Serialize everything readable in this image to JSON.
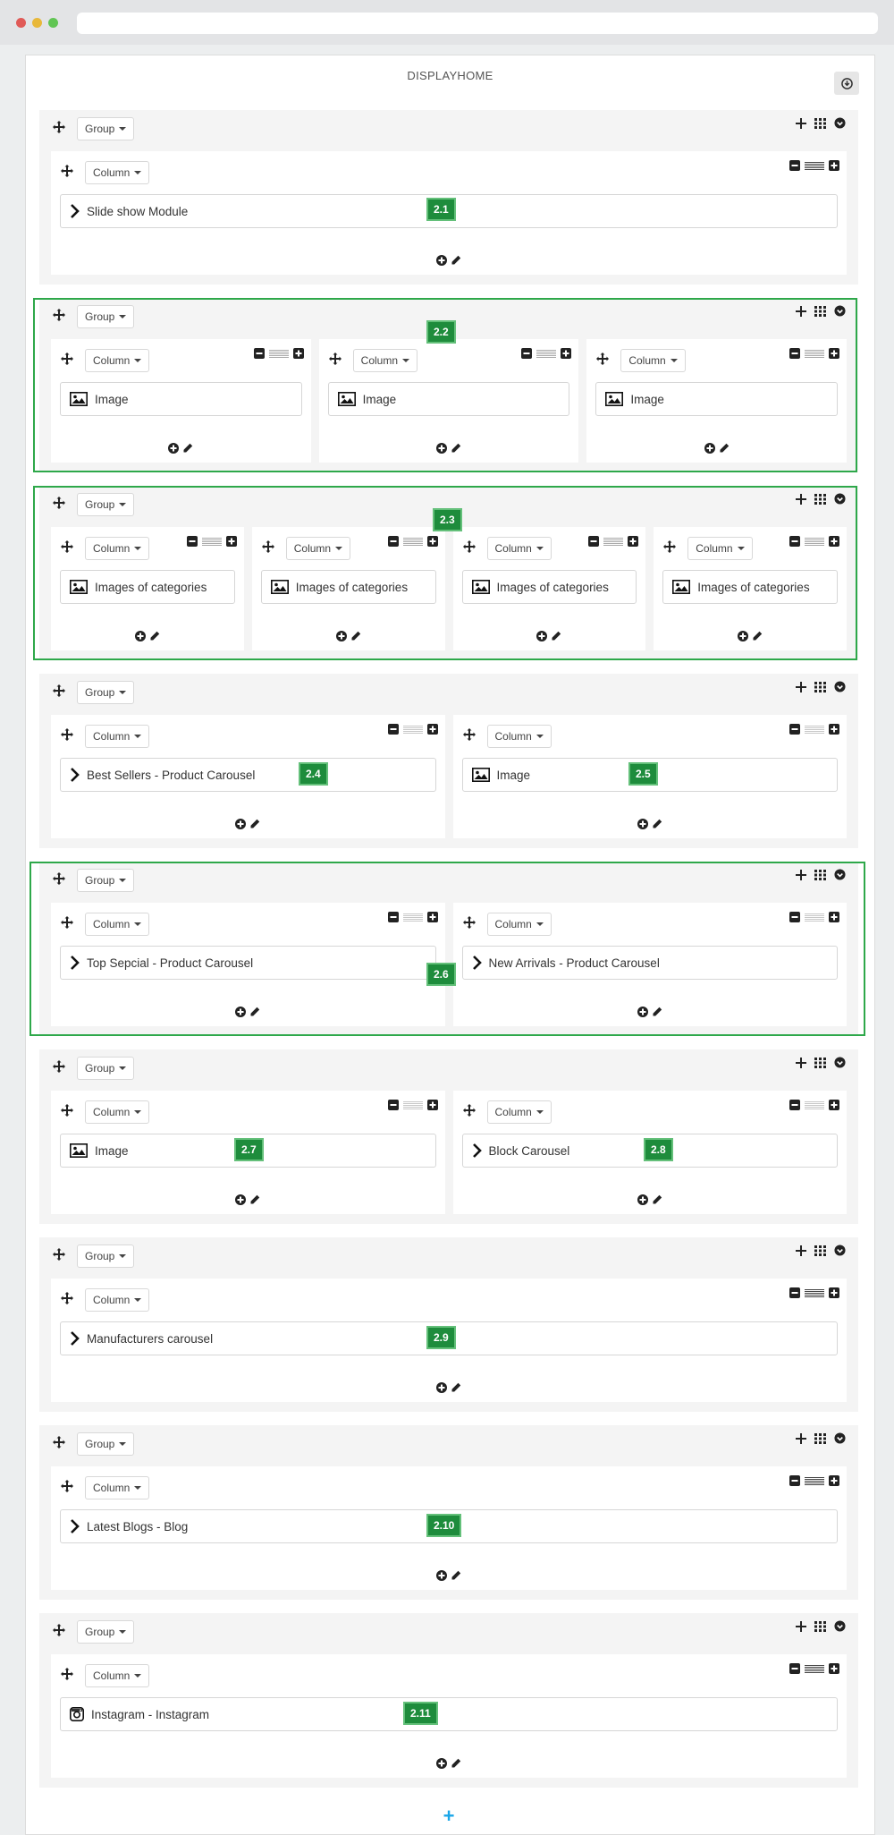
{
  "window": {
    "dots": [
      "#e05a57",
      "#e8b83a",
      "#61c554"
    ]
  },
  "panel": {
    "title": "DISPLAYHOME"
  },
  "labels": {
    "group": "Group",
    "column": "Column"
  },
  "groups": [
    {
      "badge": "2.1",
      "columns": [
        {
          "module": "Slide show Module",
          "icon": "chevron-right-icon"
        }
      ]
    },
    {
      "badge": "2.2",
      "highlighted": true,
      "columns": [
        {
          "module": "Image",
          "icon": "image-icon"
        },
        {
          "module": "Image",
          "icon": "image-icon"
        },
        {
          "module": "Image",
          "icon": "image-icon"
        }
      ]
    },
    {
      "badge": "2.3",
      "highlighted": true,
      "columns": [
        {
          "module": "Images of categories",
          "icon": "image-icon"
        },
        {
          "module": "Images of categories",
          "icon": "image-icon"
        },
        {
          "module": "Images of categories",
          "icon": "image-icon"
        },
        {
          "module": "Images of categories",
          "icon": "image-icon"
        }
      ]
    },
    {
      "columns": [
        {
          "module": "Best Sellers - Product Carousel",
          "icon": "chevron-right-icon",
          "badge": "2.4"
        },
        {
          "module": "Image",
          "icon": "image-icon",
          "badge": "2.5"
        }
      ]
    },
    {
      "highlighted": true,
      "columns": [
        {
          "module": "Top Sepcial - Product Carousel",
          "icon": "chevron-right-icon",
          "badge": "2.6"
        },
        {
          "module": "New Arrivals - Product Carousel",
          "icon": "chevron-right-icon"
        }
      ]
    },
    {
      "columns": [
        {
          "module": "Image",
          "icon": "image-icon",
          "badge": "2.7"
        },
        {
          "module": "Block Carousel",
          "icon": "chevron-right-icon",
          "badge": "2.8"
        }
      ]
    },
    {
      "badge": "2.9",
      "columns": [
        {
          "module": "Manufacturers carousel",
          "icon": "chevron-right-icon"
        }
      ]
    },
    {
      "badge": "2.10",
      "columns": [
        {
          "module": "Latest Blogs - Blog",
          "icon": "chevron-right-icon"
        }
      ]
    },
    {
      "badge": "2.11",
      "columns": [
        {
          "module": "Instagram - Instagram",
          "icon": "instagram-icon"
        }
      ]
    }
  ],
  "colors": {
    "badge": "#1e8c3c",
    "highlight": "#2ea84a",
    "add_group": "#1aa6e8"
  }
}
